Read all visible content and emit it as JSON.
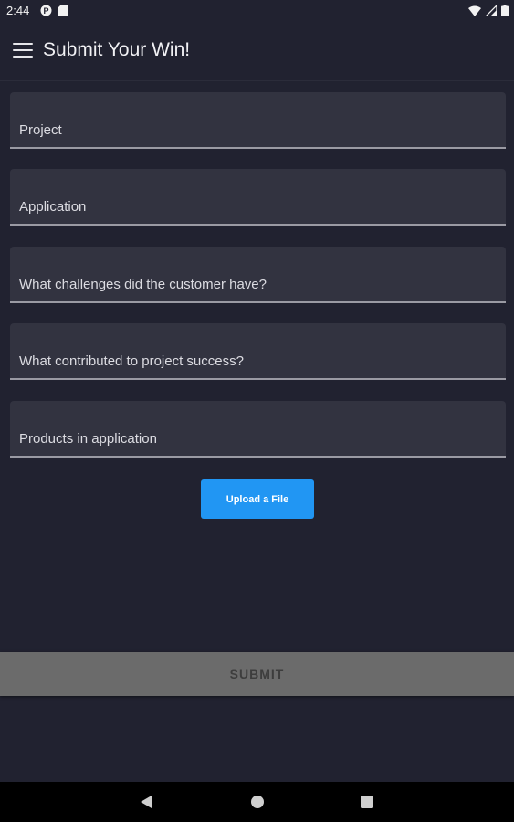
{
  "status_bar": {
    "time": "2:44",
    "left_icons": [
      "p-notification-icon",
      "sd-card-icon"
    ],
    "right_icons": [
      "wifi-icon",
      "signal-icon",
      "battery-icon"
    ]
  },
  "app_bar": {
    "title": "Submit Your Win!",
    "menu_icon": "hamburger-menu-icon"
  },
  "form": {
    "fields": [
      {
        "label": "Project"
      },
      {
        "label": "Application"
      },
      {
        "label": "What challenges did the customer have?"
      },
      {
        "label": "What contributed to project success?"
      },
      {
        "label": "Products in application"
      }
    ],
    "upload_label": "Upload a File",
    "submit_label": "SUBMIT"
  },
  "nav_bar": {
    "icons": [
      "back-icon",
      "home-icon",
      "recents-icon"
    ]
  },
  "colors": {
    "background": "#212230",
    "field_background": "#323340",
    "accent": "#2196f3",
    "submit_disabled": "#6b6b6b"
  }
}
